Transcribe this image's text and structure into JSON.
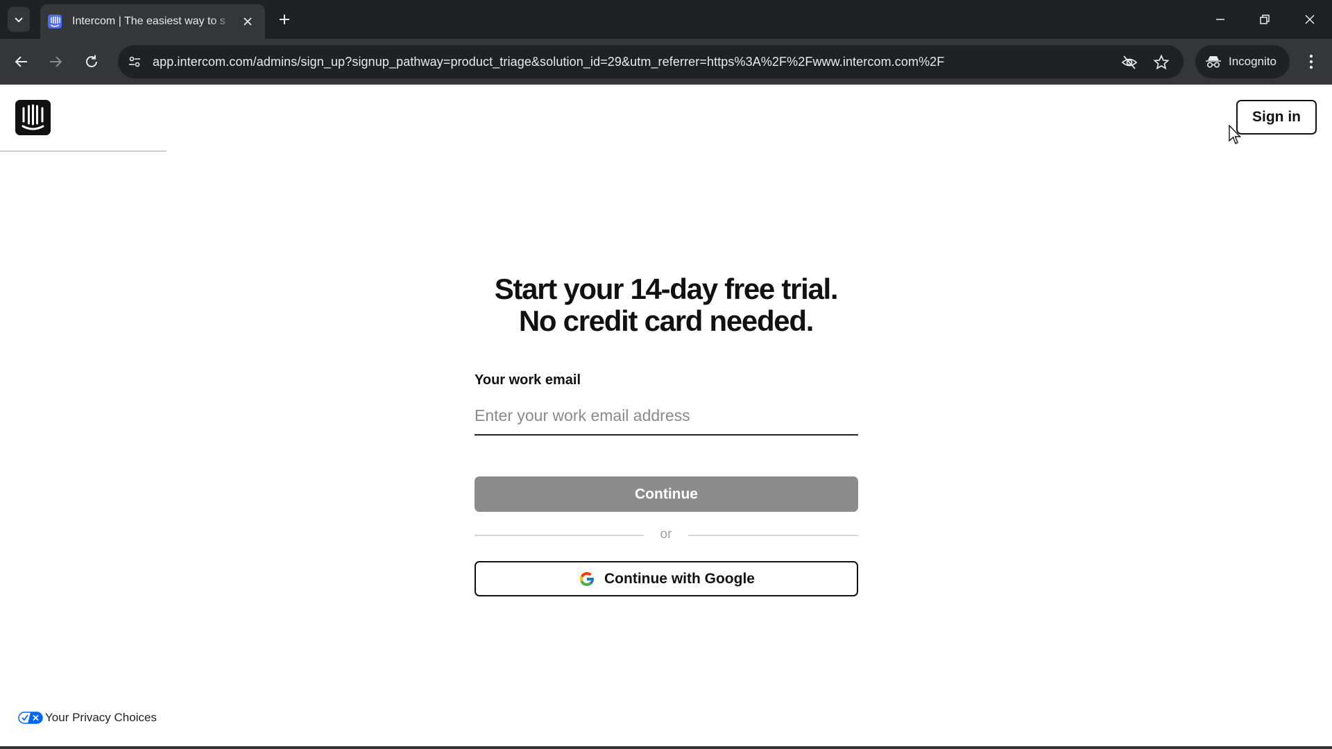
{
  "browser": {
    "tab_title": "Intercom | The easiest way to s",
    "url": "app.intercom.com/admins/sign_up?signup_pathway=product_triage&solution_id=29&utm_referrer=https%3A%2F%2Fwww.intercom.com%2F",
    "incognito_label": "Incognito"
  },
  "header": {
    "signin_label": "Sign in"
  },
  "signup": {
    "heading_line1": "Start your 14-day free trial.",
    "heading_line2": "No credit card needed.",
    "email_label": "Your work email",
    "email_placeholder": "Enter your work email address",
    "email_value": "",
    "continue_label": "Continue",
    "or_text": "or",
    "google_label": "Continue with Google"
  },
  "footer": {
    "privacy_label": "Your Privacy Choices"
  },
  "icons": {
    "tab_favicon": "intercom-logo-icon",
    "logo": "intercom-logo-icon",
    "privacy": "privacy-toggle-icon",
    "google": "google-g-icon"
  },
  "colors": {
    "chrome_dark": "#202124",
    "chrome_toolbar": "#35363a",
    "continue_disabled": "#8c8c8c",
    "text_primary": "#111111"
  }
}
